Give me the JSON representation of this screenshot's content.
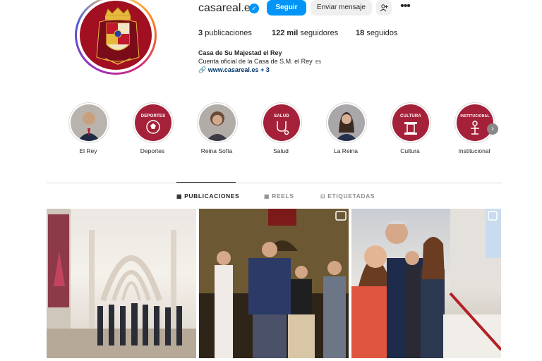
{
  "profile": {
    "username": "casareal.es",
    "follow_label": "Seguir",
    "message_label": "Enviar mensaje",
    "stats": {
      "posts_count": "3",
      "posts_label": "publicaciones",
      "followers_count": "122 mil",
      "followers_label": "seguidores",
      "following_count": "18",
      "following_label": "seguidos"
    },
    "full_name": "Casa de Su Majestad el Rey",
    "bio": "Cuenta oficial de la Casa de S.M. el Rey",
    "bio_flag": "ES",
    "website": "www.casareal.es",
    "website_more": "+ 3"
  },
  "highlights": [
    {
      "label": "El Rey",
      "icon": "portrait"
    },
    {
      "label": "Deportes",
      "word": "DEPORTES",
      "icon": "ball-icon"
    },
    {
      "label": "Reina Sofía",
      "icon": "portrait"
    },
    {
      "label": "Salud",
      "word": "SALUD",
      "icon": "stethoscope-icon"
    },
    {
      "label": "La Reina",
      "icon": "portrait"
    },
    {
      "label": "Cultura",
      "word": "CULTURA",
      "icon": "column-icon"
    },
    {
      "label": "Institucional",
      "word": "INSTITUCIONAL",
      "icon": "person-icon"
    }
  ],
  "tabs": [
    {
      "label": "PUBLICACIONES",
      "active": true
    },
    {
      "label": "REELS",
      "active": false
    },
    {
      "label": "ETIQUETADAS",
      "active": false
    }
  ],
  "colors": {
    "accent": "#0095f6",
    "highlight_bg": "#a5213a",
    "avatar_bg": "#a10f21"
  }
}
